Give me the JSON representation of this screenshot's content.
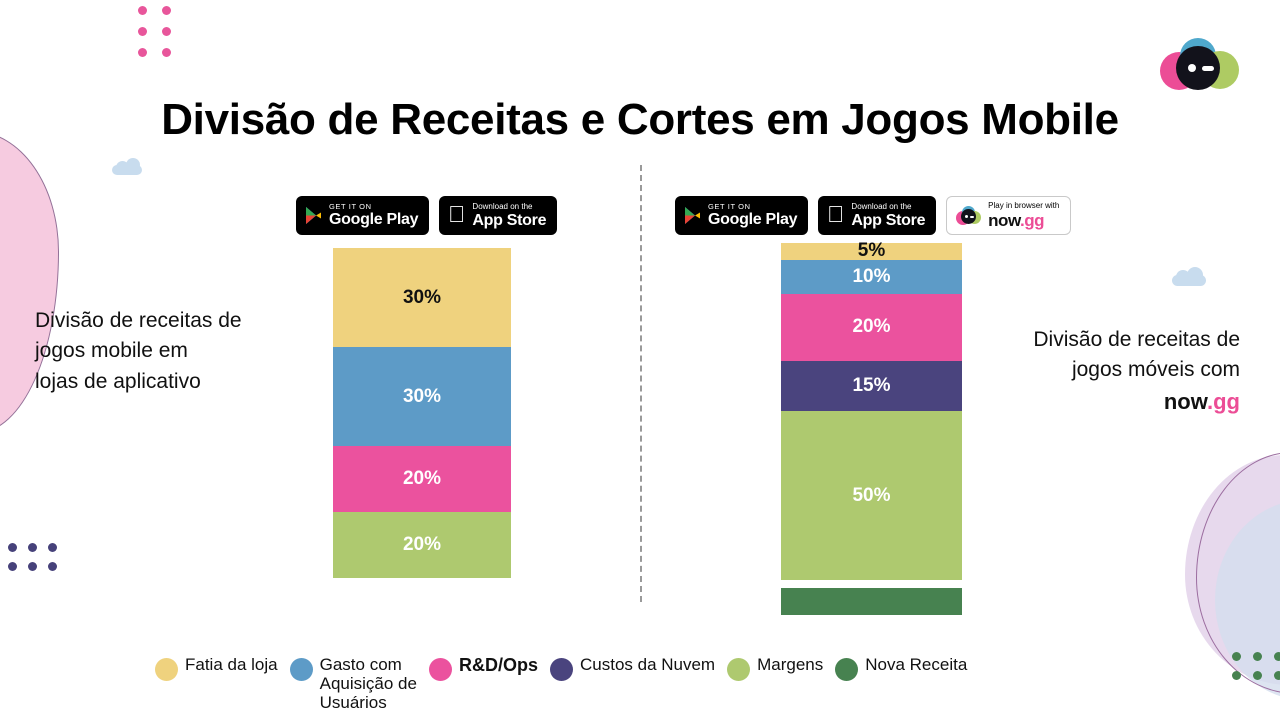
{
  "slide": {
    "title": "Divisão de Receitas e Cortes em Jogos Mobile",
    "background_color": "#FFFFFF"
  },
  "brand": {
    "logo_name": "now-gg-mascot-logo",
    "name_primary": "now",
    "name_suffix": ".gg",
    "colors": {
      "pink": "#EC4D96",
      "blue": "#4FA8CC",
      "green": "#AECB63",
      "face": "#12121B"
    }
  },
  "left_panel": {
    "caption": "Divisão de receitas de\njogos mobile em\nlojas de aplicativo",
    "badges": [
      {
        "id": "google-play",
        "small": "GET IT ON",
        "big": "Google Play",
        "icon": "google-play-icon",
        "style": "dark"
      },
      {
        "id": "app-store",
        "small": "Download on the",
        "big": "App Store",
        "icon": "apple-icon",
        "style": "dark"
      }
    ],
    "segments": [
      {
        "label": "30%",
        "value": 30,
        "category": "Fatia da loja",
        "color": "#EFD27E",
        "text_color": "dark"
      },
      {
        "label": "30%",
        "value": 30,
        "category": "Gasto com Aquisição de Usuários",
        "color": "#5D9BC7",
        "text_color": "light"
      },
      {
        "label": "20%",
        "value": 20,
        "category": "R&D/Ops",
        "color": "#EB529E",
        "text_color": "light"
      },
      {
        "label": "20%",
        "value": 20,
        "category": "Margens",
        "color": "#AEC96F",
        "text_color": "light"
      }
    ]
  },
  "right_panel": {
    "caption_line1": "Divisão de receitas de",
    "caption_line2": "jogos móveis com",
    "badges": [
      {
        "id": "google-play",
        "small": "GET IT ON",
        "big": "Google Play",
        "icon": "google-play-icon",
        "style": "dark"
      },
      {
        "id": "app-store",
        "small": "Download on the",
        "big": "App Store",
        "icon": "apple-icon",
        "style": "dark"
      },
      {
        "id": "now-gg",
        "small": "Play in browser with",
        "big": "now.gg",
        "icon": "now-gg-icon",
        "style": "light"
      }
    ],
    "segments": [
      {
        "label": "5%",
        "value": 5,
        "category": "Fatia da loja",
        "color": "#EFD27E",
        "text_color": "dark"
      },
      {
        "label": "10%",
        "value": 10,
        "category": "Gasto com Aquisição de Usuários",
        "color": "#5D9BC7",
        "text_color": "light"
      },
      {
        "label": "20%",
        "value": 20,
        "category": "R&D/Ops",
        "color": "#EB529E",
        "text_color": "light"
      },
      {
        "label": "15%",
        "value": 15,
        "category": "Custos da Nuvem",
        "color": "#4A447E",
        "text_color": "light"
      },
      {
        "label": "50%",
        "value": 50,
        "category": "Margens",
        "color": "#AEC96F",
        "text_color": "light"
      }
    ],
    "extra_bar": {
      "label": "",
      "category": "Nova Receita",
      "color": "#478250"
    }
  },
  "legend": {
    "items": [
      {
        "label": "Fatia da loja",
        "color": "#EFD27E",
        "bold": false
      },
      {
        "label": "Gasto com\nAquisição de\nUsuários",
        "color": "#5D9BC7",
        "bold": false
      },
      {
        "label": "R&D/Ops",
        "color": "#EB529E",
        "bold": true
      },
      {
        "label": "Custos da Nuvem",
        "color": "#4A447E",
        "bold": false
      },
      {
        "label": "Margens",
        "color": "#AEC96F",
        "bold": false
      },
      {
        "label": "Nova Receita",
        "color": "#478250",
        "bold": false
      }
    ]
  },
  "decorations": {
    "dots_top_left_color": "#E8569B",
    "dots_bottom_left_color": "#46417A",
    "dots_bottom_right_color": "#478250",
    "blob_left_color": "#F6C9DF",
    "cloud_color": "#C8DCEE"
  },
  "chart_data": {
    "type": "bar",
    "title": "Divisão de Receitas e Cortes em Jogos Mobile",
    "subtype": "stacked-bar-100",
    "categories": [
      "Lojas de aplicativo",
      "now.gg"
    ],
    "series": [
      {
        "name": "Fatia da loja",
        "color": "#EFD27E",
        "values": [
          30,
          5
        ]
      },
      {
        "name": "Gasto com Aquisição de Usuários",
        "color": "#5D9BC7",
        "values": [
          30,
          10
        ]
      },
      {
        "name": "R&D/Ops",
        "color": "#EB529E",
        "values": [
          20,
          20
        ]
      },
      {
        "name": "Custos da Nuvem",
        "color": "#4A447E",
        "values": [
          0,
          15
        ]
      },
      {
        "name": "Margens",
        "color": "#AEC96F",
        "values": [
          20,
          50
        ]
      },
      {
        "name": "Nova Receita",
        "color": "#478250",
        "values": [
          0,
          null
        ]
      }
    ],
    "unit": "%",
    "ylim": [
      0,
      100
    ],
    "grid": false,
    "legend_position": "bottom",
    "annotations": [
      "Divisão de receitas de jogos mobile em lojas de aplicativo",
      "Divisão de receitas de jogos móveis com now.gg"
    ]
  }
}
